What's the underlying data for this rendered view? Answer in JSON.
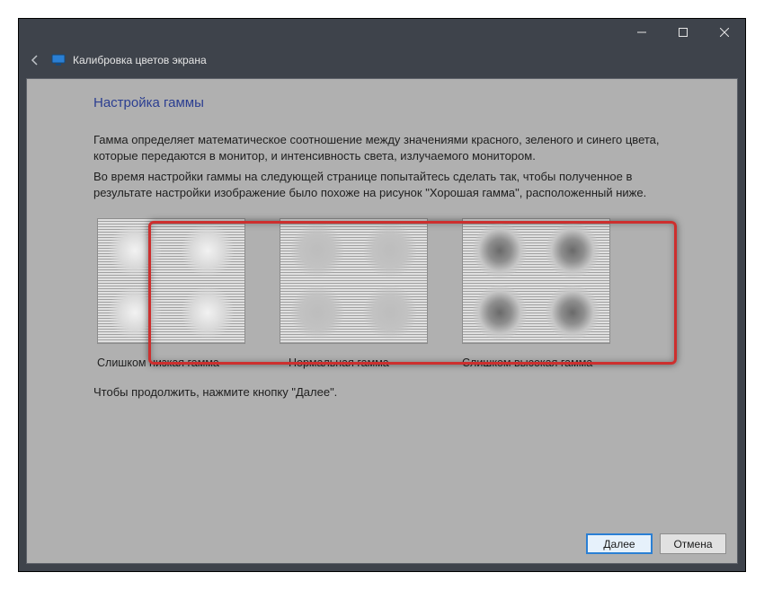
{
  "window": {
    "title": "Калибровка цветов экрана"
  },
  "page": {
    "title": "Настройка гаммы",
    "paragraph1": "Гамма определяет математическое соотношение между значениями красного, зеленого и синего цвета, которые передаются в монитор, и интенсивность света, излучаемого монитором.",
    "paragraph2": "Во время настройки гаммы на следующей странице попытайтесь сделать так, чтобы полученное в результате настройки изображение было похоже на рисунок \"Хорошая гамма\", расположенный ниже.",
    "continue_text": "Чтобы продолжить, нажмите кнопку \"Далее\"."
  },
  "samples": {
    "low_label": "Слишком низкая гамма",
    "mid_label": "Нормальная гамма",
    "high_label": "Слишком высокая гамма"
  },
  "buttons": {
    "next": "Далее",
    "cancel": "Отмена"
  }
}
